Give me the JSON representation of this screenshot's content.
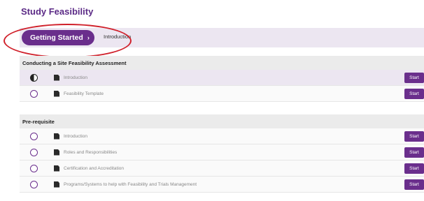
{
  "page_title": "Study Feasibility",
  "progress": {
    "button_label": "Getting Started",
    "chevron": "›",
    "current_step": "Introduction"
  },
  "annotation": {
    "shape": "ellipse",
    "color": "#d0202a",
    "target": "getting-started-button"
  },
  "sections": [
    {
      "title": "Conducting a Site Feasibility Assessment",
      "items": [
        {
          "status": "in-progress",
          "icon": "document-icon",
          "label": "Introduction",
          "action": "Start"
        },
        {
          "status": "not-started",
          "icon": "document-icon",
          "label": "Feasibility Template",
          "action": "Start"
        }
      ]
    },
    {
      "title": "Pre-requisite",
      "items": [
        {
          "status": "not-started",
          "icon": "document-icon",
          "label": "Introduction",
          "action": "Start"
        },
        {
          "status": "not-started",
          "icon": "document-icon",
          "label": "Roles and Responsibilities",
          "action": "Start"
        },
        {
          "status": "not-started",
          "icon": "document-icon",
          "label": "Certification and Accreditation",
          "action": "Start"
        },
        {
          "status": "not-started",
          "icon": "document-icon",
          "label": "Programs/Systems to help with Feasibility and Trials Management",
          "action": "Start"
        }
      ]
    }
  ],
  "colors": {
    "accent": "#6a2e8c",
    "title": "#5b2a86",
    "annotation": "#d0202a"
  }
}
